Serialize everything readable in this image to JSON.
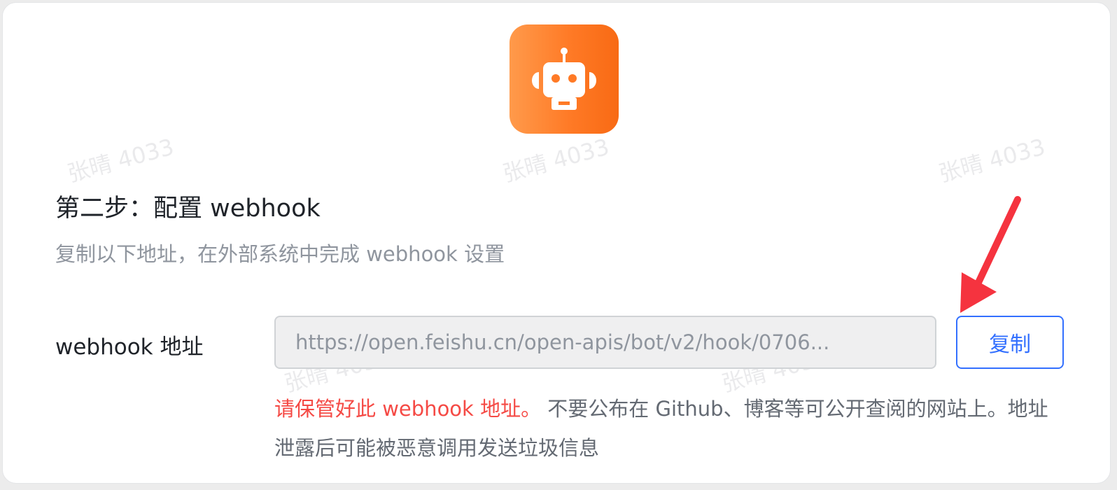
{
  "watermark": "张晴 4033",
  "step": {
    "title": "第二步：配置 webhook",
    "description": "复制以下地址，在外部系统中完成 webhook 设置"
  },
  "webhook": {
    "label": "webhook 地址",
    "url_display": "https://open.feishu.cn/open-apis/bot/v2/hook/0706...",
    "copy_label": "复制"
  },
  "warning": {
    "highlight": "请保管好此 webhook 地址。",
    "rest": " 不要公布在 Github、博客等可公开查阅的网站上。地址泄露后可能被恶意调用发送垃圾信息"
  },
  "icons": {
    "bot": "robot-icon",
    "annotation": "red-arrow-icon"
  },
  "colors": {
    "accent_blue": "#3370ff",
    "warning_red": "#f54a45",
    "bot_orange": "#ff7a26",
    "arrow_red": "#f5333f"
  }
}
